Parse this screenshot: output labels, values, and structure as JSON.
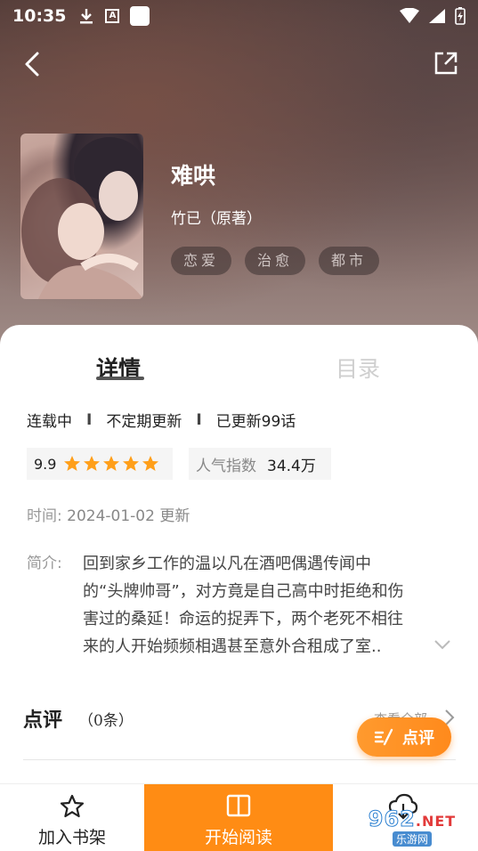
{
  "status_bar": {
    "time": "10:35",
    "icons_left": [
      "download-icon",
      "a-box-icon",
      "square-icon"
    ],
    "icons_right": [
      "wifi-icon",
      "signal-icon",
      "battery-charging-icon"
    ]
  },
  "header": {
    "back_icon": "chevron-left-icon",
    "share_icon": "share-external-icon"
  },
  "book": {
    "title": "难哄",
    "author": "竹已（原著）",
    "tags": [
      "恋爱",
      "治愈",
      "都市"
    ]
  },
  "tabs": {
    "detail": "详情",
    "toc": "目录",
    "active": "detail"
  },
  "info": {
    "serial_status": "连载中",
    "update_schedule": "不定期更新",
    "updated_count": "已更新99话",
    "separator": "I",
    "rating": "9.9",
    "stars": 5,
    "popularity_label": "人气指数",
    "popularity_value": "34.4万",
    "time_label": "时间:",
    "time_value": "2024-01-02 更新",
    "intro_label": "简介:",
    "intro_lines": [
      "回到家乡工作的温以凡在酒吧偶遇传闻中",
      "的“头牌帅哥”，对方竟是自己高中时拒绝和伤",
      "害过的桑延！命运的捉弄下，两个老死不相往",
      "来的人开始频频相遇甚至意外合租成了室.."
    ]
  },
  "reviews": {
    "title": "点评",
    "count": "（0条）",
    "view_all": "查看全部",
    "comment_button": "点评"
  },
  "bottom_bar": {
    "shelf_label": "加入书架",
    "read_label": "开始阅读"
  },
  "watermark": {
    "number": "962",
    "suffix": ".NET",
    "sub": "乐游网"
  },
  "colors": {
    "accent": "#ff8c14",
    "star": "#ff9f1a"
  }
}
